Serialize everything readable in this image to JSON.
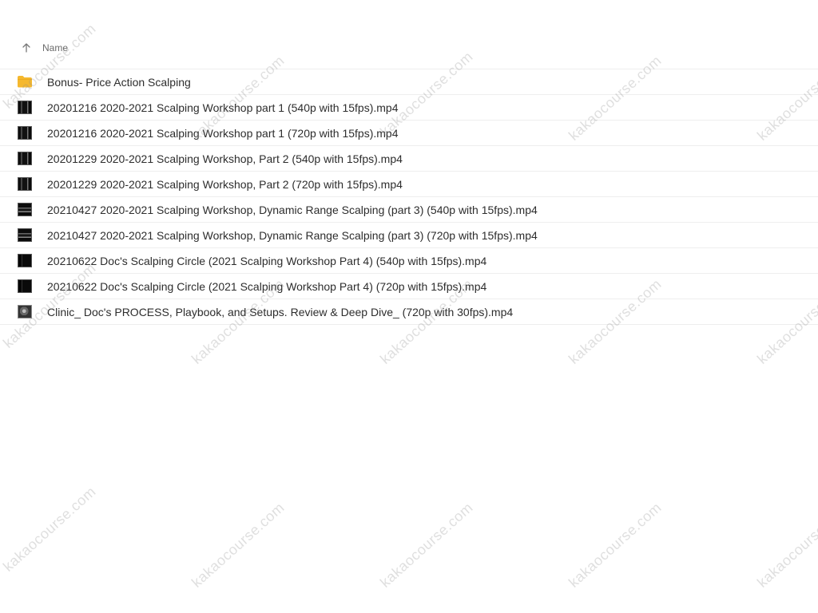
{
  "header": {
    "column_label": "Name",
    "sort_icon": "arrow-up-icon"
  },
  "files": [
    {
      "name": "Bonus- Price Action Scalping",
      "type": "folder",
      "icon": "folder-icon"
    },
    {
      "name": "20201216 2020-2021 Scalping Workshop part 1 (540p with 15fps).mp4",
      "type": "video",
      "icon": "video-thumbnail-icon"
    },
    {
      "name": "20201216 2020-2021 Scalping Workshop part 1 (720p with 15fps).mp4",
      "type": "video",
      "icon": "video-thumbnail-icon"
    },
    {
      "name": "20201229 2020-2021 Scalping Workshop, Part 2 (540p with 15fps).mp4",
      "type": "video",
      "icon": "video-thumbnail-icon"
    },
    {
      "name": "20201229 2020-2021 Scalping Workshop, Part 2 (720p with 15fps).mp4",
      "type": "video",
      "icon": "video-thumbnail-icon"
    },
    {
      "name": "20210427 2020-2021 Scalping Workshop, Dynamic Range Scalping (part 3) (540p with 15fps).mp4",
      "type": "video",
      "icon": "video-thumbnail-icon"
    },
    {
      "name": "20210427 2020-2021 Scalping Workshop, Dynamic Range Scalping (part 3) (720p with 15fps).mp4",
      "type": "video",
      "icon": "video-thumbnail-icon"
    },
    {
      "name": "20210622 Doc's Scalping Circle (2021 Scalping Workshop Part 4) (540p with 15fps).mp4",
      "type": "video",
      "icon": "video-thumbnail-icon"
    },
    {
      "name": "20210622 Doc's Scalping Circle (2021 Scalping Workshop Part 4) (720p with 15fps).mp4",
      "type": "video",
      "icon": "video-thumbnail-icon"
    },
    {
      "name": "Clinic_ Doc's PROCESS, Playbook, and Setups. Review & Deep Dive_ (720p with 30fps).mp4",
      "type": "video",
      "icon": "video-thumbnail-icon"
    }
  ],
  "watermark": {
    "text": "kakaocourse.com"
  },
  "colors": {
    "folder": "#F5B82E",
    "divider": "#EEEEEE",
    "text": "#2D2D2D"
  }
}
